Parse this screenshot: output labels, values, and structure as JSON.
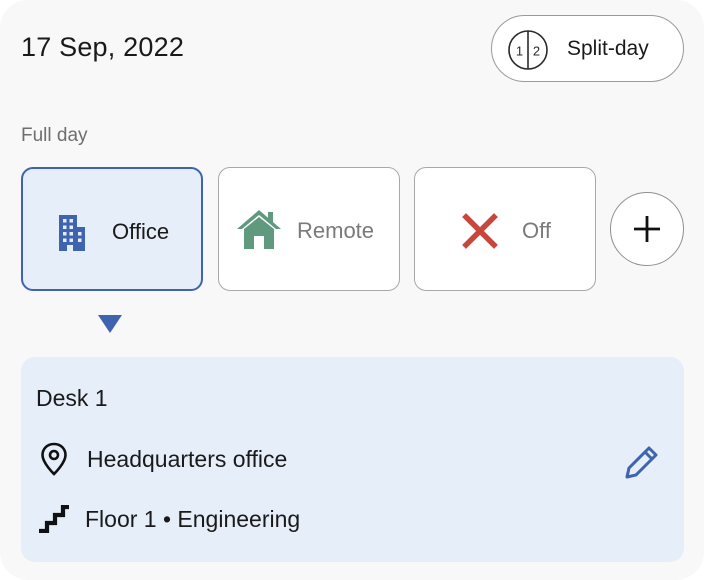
{
  "header": {
    "date": "17 Sep, 2022",
    "split_label": "Split-day",
    "split_icon_left": "1",
    "split_icon_right": "2"
  },
  "full_day_label": "Full day",
  "options": [
    {
      "label": "Office",
      "icon": "office-building-icon",
      "selected": true,
      "color": "#3e64b0"
    },
    {
      "label": "Remote",
      "icon": "home-icon",
      "selected": false,
      "color": "#5f9a7e"
    },
    {
      "label": "Off",
      "icon": "close-x-icon",
      "selected": false,
      "color": "#c8473d"
    }
  ],
  "add_icon": "plus-icon",
  "detail": {
    "desk": "Desk 1",
    "location": "Headquarters office",
    "floor": "Floor 1 • Engineering"
  },
  "colors": {
    "accent": "#3e64b0",
    "selected_bg": "#e6eefa",
    "remote_green": "#5f9a7e",
    "off_red": "#c8473d"
  }
}
